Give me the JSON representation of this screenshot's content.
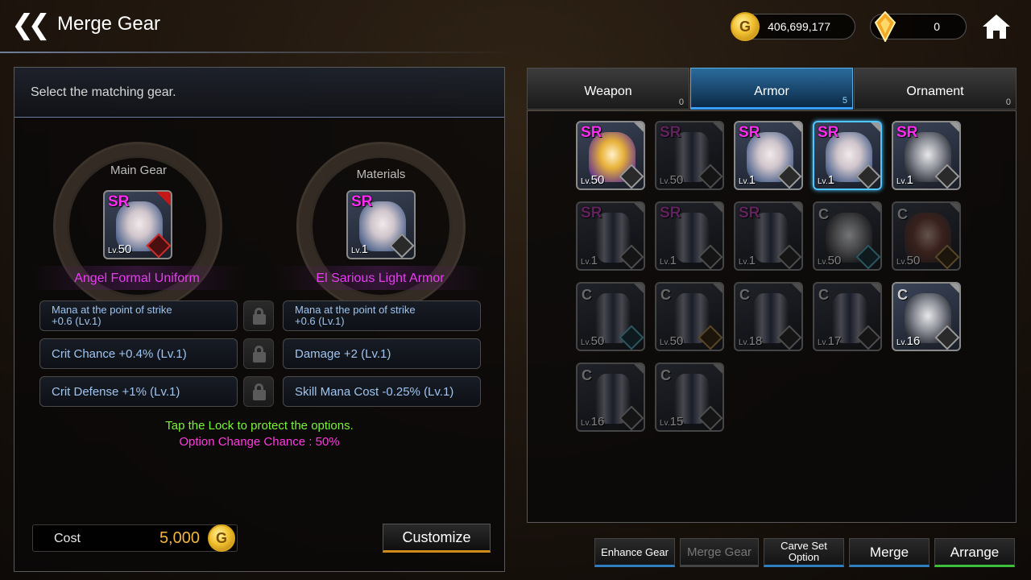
{
  "header": {
    "title": "Merge Gear",
    "gold": "406,699,177",
    "gems": "0"
  },
  "left": {
    "instruction": "Select the matching gear.",
    "main_label": "Main Gear",
    "materials_label": "Materials",
    "main_item": {
      "rarity": "SR",
      "lv": "50",
      "name": "Angel Formal Uniform"
    },
    "material_item": {
      "rarity": "SR",
      "lv": "1",
      "name": "El Sarious Light Armor"
    },
    "main_options": [
      {
        "line1": "Mana at the point of strike",
        "line2": "+0.6 (Lv.1)"
      },
      {
        "text": "Crit Chance +0.4% (Lv.1)"
      },
      {
        "text": "Crit Defense +1% (Lv.1)"
      }
    ],
    "material_options": [
      {
        "line1": "Mana at the point of strike",
        "line2": "+0.6 (Lv.1)"
      },
      {
        "text": "Damage +2 (Lv.1)"
      },
      {
        "text": "Skill Mana Cost -0.25% (Lv.1)"
      }
    ],
    "tip_lock": "Tap the Lock to protect the options.",
    "tip_chance": "Option Change Chance : 50%",
    "cost_label": "Cost",
    "cost_value": "5,000",
    "customize": "Customize"
  },
  "tabs": [
    {
      "label": "Weapon",
      "count": "0"
    },
    {
      "label": "Armor",
      "count": "5"
    },
    {
      "label": "Ornament",
      "count": "0"
    }
  ],
  "inventory": [
    {
      "rarity": "SR",
      "lv": "50",
      "look": "gold",
      "sock": "",
      "dim": false,
      "sel": false
    },
    {
      "rarity": "SR",
      "lv": "50",
      "look": "legs",
      "sock": "",
      "dim": true,
      "sel": false
    },
    {
      "rarity": "SR",
      "lv": "1",
      "look": "",
      "sock": "",
      "dim": false,
      "sel": false
    },
    {
      "rarity": "SR",
      "lv": "1",
      "look": "",
      "sock": "",
      "dim": false,
      "sel": true
    },
    {
      "rarity": "SR",
      "lv": "1",
      "look": "silver",
      "sock": "",
      "dim": false,
      "sel": false
    },
    {
      "rarity": "SR",
      "lv": "1",
      "look": "legs",
      "sock": "",
      "dim": true,
      "sel": false
    },
    {
      "rarity": "SR",
      "lv": "1",
      "look": "legs",
      "sock": "",
      "dim": true,
      "sel": false
    },
    {
      "rarity": "SR",
      "lv": "1",
      "look": "legs",
      "sock": "",
      "dim": true,
      "sel": false
    },
    {
      "rarity": "C",
      "lv": "50",
      "look": "silver",
      "sock": "teal",
      "dim": true,
      "sel": false
    },
    {
      "rarity": "C",
      "lv": "50",
      "look": "brown",
      "sock": "orange",
      "dim": true,
      "sel": false
    },
    {
      "rarity": "C",
      "lv": "50",
      "look": "legs",
      "sock": "teal",
      "dim": true,
      "sel": false
    },
    {
      "rarity": "C",
      "lv": "50",
      "look": "legs",
      "sock": "orange",
      "dim": true,
      "sel": false
    },
    {
      "rarity": "C",
      "lv": "18",
      "look": "legs",
      "sock": "",
      "dim": true,
      "sel": false
    },
    {
      "rarity": "C",
      "lv": "17",
      "look": "legs",
      "sock": "",
      "dim": true,
      "sel": false
    },
    {
      "rarity": "C",
      "lv": "16",
      "look": "silver",
      "sock": "",
      "dim": false,
      "sel": false
    },
    {
      "rarity": "C",
      "lv": "16",
      "look": "legs",
      "sock": "",
      "dim": true,
      "sel": false
    },
    {
      "rarity": "C",
      "lv": "15",
      "look": "legs",
      "sock": "",
      "dim": true,
      "sel": false
    }
  ],
  "bottom_buttons": {
    "enhance": "Enhance Gear",
    "merge_gear": "Merge Gear",
    "carve1": "Carve Set",
    "carve2": "Option",
    "merge": "Merge",
    "arrange": "Arrange"
  },
  "colors": {
    "sr": "#ff2cf2",
    "name": "#e83df2",
    "tip_green": "#7af23a",
    "tip_magenta": "#ff3ae0",
    "option_text": "#9fc4f0",
    "cost_gold": "#f2b640",
    "tab_active": "#2a6b9c"
  },
  "icons": [
    "back-chevron-icon",
    "gold-coin-icon",
    "gem-icon",
    "home-icon",
    "lock-icon",
    "gear-socket-icon"
  ]
}
